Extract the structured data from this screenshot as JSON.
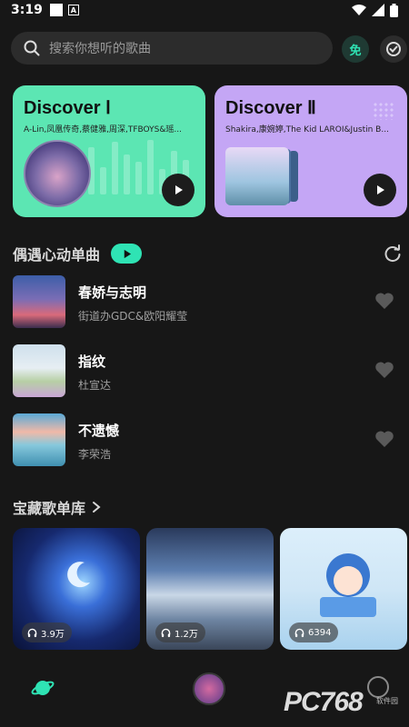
{
  "status_bar": {
    "time": "3:19"
  },
  "search": {
    "placeholder": "搜索你想听的歌曲"
  },
  "header": {
    "free_badge": "免"
  },
  "discover": [
    {
      "title": "Discover Ⅰ",
      "artists": "A-Lin,凤凰传奇,蔡健雅,周深,TFBOYS&瑶..."
    },
    {
      "title": "Discover Ⅱ",
      "artists": "Shakira,康婉婷,The Kid LAROI&Justin B..."
    }
  ],
  "daily_section": {
    "title": "偶遇心动单曲"
  },
  "songs": [
    {
      "name": "春娇与志明",
      "artist": "街道办GDC&欧阳耀莹"
    },
    {
      "name": "指纹",
      "artist": "杜宣达"
    },
    {
      "name": "不遗憾",
      "artist": "李荣浩"
    }
  ],
  "playlists_section": {
    "title": "宝藏歌单库"
  },
  "playlists": [
    {
      "play_count": "3.9万"
    },
    {
      "play_count": "1.2万"
    },
    {
      "play_count": "6394"
    }
  ],
  "watermark": {
    "main": "PC768",
    "sub": "软件园"
  },
  "colors": {
    "accent": "#2fe3b4",
    "card_green": "#5ce6b3",
    "card_purple": "#c4a6f5",
    "background": "#171717"
  }
}
